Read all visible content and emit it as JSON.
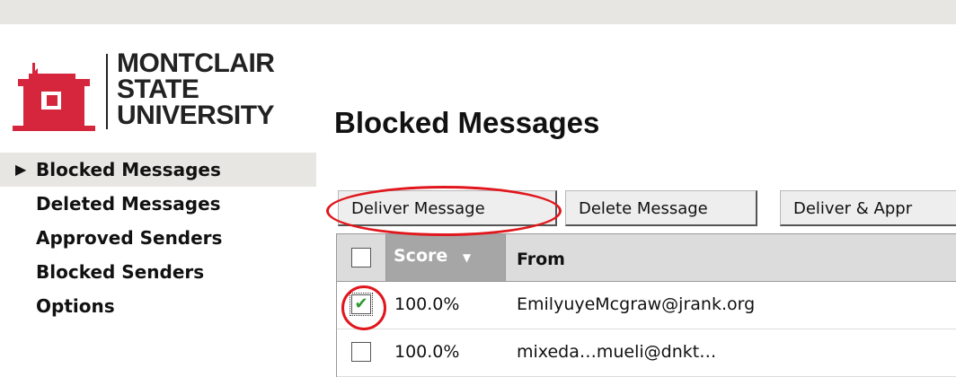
{
  "logo": {
    "lines": [
      "MONTCLAIR",
      "STATE",
      "UNIVERSITY"
    ],
    "icon": "university-building-icon",
    "brand_color": "#d6263d"
  },
  "page": {
    "title": "Blocked Messages"
  },
  "nav": {
    "active_arrow": "▶",
    "items": [
      {
        "label": "Blocked Messages"
      },
      {
        "label": "Deleted Messages"
      },
      {
        "label": "Approved Senders"
      },
      {
        "label": "Blocked Senders"
      },
      {
        "label": "Options"
      }
    ]
  },
  "toolbar": {
    "deliver_label": "Deliver Message",
    "delete_label": "Delete Message",
    "deliver_approve_label": "Deliver & Appr"
  },
  "grid": {
    "headers": {
      "score": "Score",
      "from": "From"
    },
    "sort_icon": "▼",
    "rows": [
      {
        "checked": true,
        "score": "100.0%",
        "from": "EmilyuyeMcgraw@jrank.org"
      },
      {
        "checked": false,
        "score": "100.0%",
        "from": "mixeda…mueli@dnkt…"
      }
    ]
  },
  "annotation_color": "#e0171d"
}
